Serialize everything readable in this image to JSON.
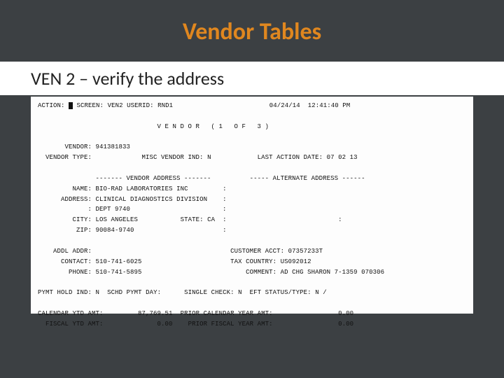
{
  "title": "Vendor Tables",
  "subtitle": "VEN 2 – verify the address",
  "term": {
    "action_label": "ACTION:",
    "screen_label": "SCREEN:",
    "screen_val": "VEN2",
    "userid_label": "USERID:",
    "userid_val": "RND1",
    "date": "04/24/14",
    "time": "12:41:40 PM",
    "banner": "V E N D O R   ( 1   O F   3 )",
    "vendor_label": "VENDOR:",
    "vendor_val": "941381833",
    "vendor_type_label": "VENDOR TYPE:",
    "misc_ind_label": "MISC VENDOR IND:",
    "misc_ind_val": "N",
    "last_action_label": "LAST ACTION DATE:",
    "last_action_val": "07 02 13",
    "addr_header": "------- VENDOR ADDRESS -------",
    "alt_header": "----- ALTERNATE ADDRESS ------",
    "name_label": "NAME:",
    "name_val": "BIO-RAD LABORATORIES INC",
    "address_label": "ADDRESS:",
    "addr1": "CLINICAL DIAGNOSTICS DIVISION",
    "addr2": "DEPT 9740",
    "city_label": "CITY:",
    "city_val": "LOS ANGELES",
    "state_label": "STATE:",
    "state_val": "CA",
    "zip_label": "ZIP:",
    "zip_val": "90084-9740",
    "addl_addr_label": "ADDL ADDR:",
    "cust_acct_label": "CUSTOMER ACCT:",
    "cust_acct_val": "07357233T",
    "contact_label": "CONTACT:",
    "contact_val": "510-741-6025",
    "tax_country_label": "TAX COUNTRY:",
    "tax_country_val": "US092012",
    "phone_label": "PHONE:",
    "phone_val": "510-741-5895",
    "comment_label": "COMMENT:",
    "comment_val": "AD CHG SHARON 7-1359 070306",
    "pymt_hold_label": "PYMT HOLD IND:",
    "pymt_hold_val": "N",
    "schd_label": "SCHD PYMT DAY:",
    "single_check_label": "SINGLE CHECK:",
    "single_check_val": "N",
    "eft_label": "EFT STATUS/TYPE:",
    "eft_val": "N /",
    "cal_ytd_label": "CALENDAR YTD AMT:",
    "cal_ytd_val": "87,769.51",
    "prior_cal_label": "PRIOR CALENDAR YEAR AMT:",
    "prior_cal_val": "0.00",
    "fisc_ytd_label": "FISCAL YTD AMT:",
    "fisc_ytd_val": "0.00",
    "prior_fisc_label": "PRIOR FISCAL YEAR AMT:",
    "prior_fisc_val": "0.00"
  }
}
